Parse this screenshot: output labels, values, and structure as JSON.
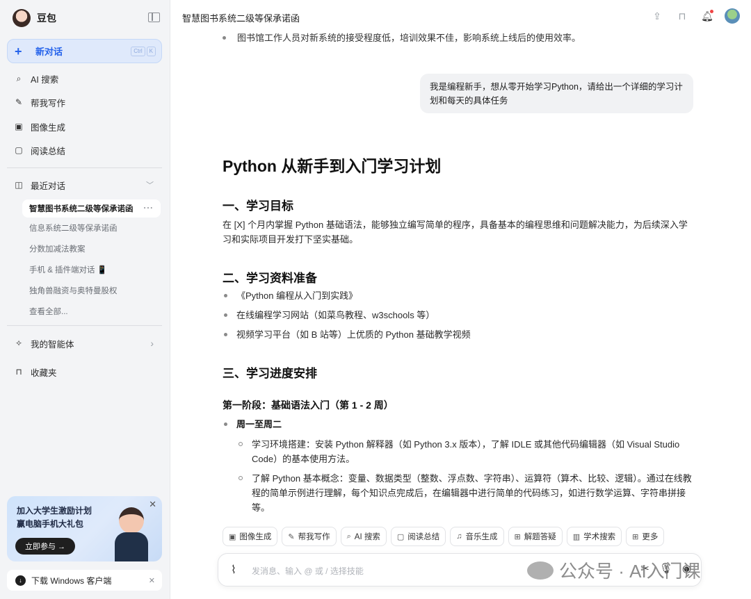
{
  "sidebar": {
    "brand": "豆包",
    "new_chat": "新对话",
    "shortcut": [
      "Ctrl",
      "K"
    ],
    "nav": [
      {
        "label": "AI 搜索",
        "icon": "ai-search-icon"
      },
      {
        "label": "帮我写作",
        "icon": "pen-icon"
      },
      {
        "label": "图像生成",
        "icon": "image-icon"
      },
      {
        "label": "阅读总结",
        "icon": "book-icon"
      }
    ],
    "recent_header": "最近对话",
    "recent": [
      "智慧图书系统二级等保承诺函",
      "信息系统二级等保承诺函",
      "分数加减法教案",
      "手机 & 插件端对话 📱",
      "独角兽融资与奥特曼股权",
      "查看全部..."
    ],
    "agents": "我的智能体",
    "favorites": "收藏夹",
    "promo": {
      "line1": "加入大学生激励计划",
      "line2": "赢电脑手机大礼包",
      "button": "立即参与 →"
    },
    "download": "下载 Windows 客户端"
  },
  "header": {
    "title": "智慧图书系统二级等保承诺函"
  },
  "conversation": {
    "cutoff_text": "图书馆工作人员对新系统的接受程度低，培训效果不佳，影响系统上线后的使用效率。",
    "user_message": "我是编程新手，想从零开始学习Python，请给出一个详细的学习计划和每天的具体任务",
    "doc": {
      "title": "Python 从新手到入门学习计划",
      "s1_heading": "一、学习目标",
      "s1_text": "在 [X] 个月内掌握 Python 基础语法，能够独立编写简单的程序，具备基本的编程思维和问题解决能力，为后续深入学习和实际项目开发打下坚实基础。",
      "s2_heading": "二、学习资料准备",
      "s2_items": [
        "《Python 编程从入门到实践》",
        "在线编程学习网站（如菜鸟教程、w3schools 等）",
        "视频学习平台（如 B 站等）上优质的 Python 基础教学视频"
      ],
      "s3_heading": "三、学习进度安排",
      "phase1": "第一阶段：基础语法入门（第 1 - 2 周）",
      "days": "周一至周二",
      "tasks": [
        "学习环境搭建：安装 Python 解释器（如 Python 3.x 版本），了解 IDLE 或其他代码编辑器（如 Visual Studio Code）的基本使用方法。",
        "了解 Python 基本概念：变量、数据类型（整数、浮点数、字符串）、运算符（算术、比较、逻辑）。通过在线教程的简单示例进行理解，每个知识点完成后，在编辑器中进行简单的代码练习，如进行数学运算、字符串拼接等。"
      ]
    }
  },
  "skills": [
    {
      "label": "图像生成",
      "icon": "image-icon"
    },
    {
      "label": "帮我写作",
      "icon": "pen-icon"
    },
    {
      "label": "AI 搜索",
      "icon": "ai-search-icon"
    },
    {
      "label": "阅读总结",
      "icon": "book-icon"
    },
    {
      "label": "音乐生成",
      "icon": "music-icon"
    },
    {
      "label": "解题答疑",
      "icon": "solve-icon"
    },
    {
      "label": "学术搜索",
      "icon": "academic-icon"
    },
    {
      "label": "更多",
      "icon": "grid-icon"
    }
  ],
  "composer": {
    "placeholder": "发消息、输入 @ 或 / 选择技能"
  },
  "watermark": "公众号 · AI入门课"
}
